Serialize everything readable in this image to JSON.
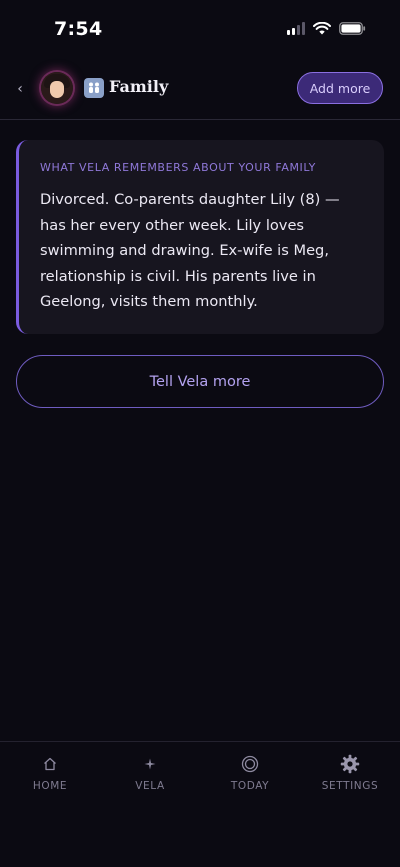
{
  "status": {
    "time": "7:54"
  },
  "header": {
    "title": "Family",
    "add_more_label": "Add more"
  },
  "memory": {
    "heading": "WHAT VELA REMEMBERS ABOUT YOUR FAMILY",
    "text": "Divorced. Co-parents daughter Lily (8) — has her every other week. Lily loves swimming and drawing. Ex-wife is Meg, relationship is civil. His parents live in Geelong, visits them monthly."
  },
  "tell_more_label": "Tell Vela more",
  "nav": {
    "items": [
      {
        "label": "HOME",
        "icon": "home-icon"
      },
      {
        "label": "VELA",
        "icon": "sparkle-icon"
      },
      {
        "label": "TODAY",
        "icon": "target-icon"
      },
      {
        "label": "SETTINGS",
        "icon": "gear-icon"
      }
    ]
  },
  "colors": {
    "accent": "#7b5ce0",
    "background": "#0b0a12",
    "card": "#17151f"
  }
}
